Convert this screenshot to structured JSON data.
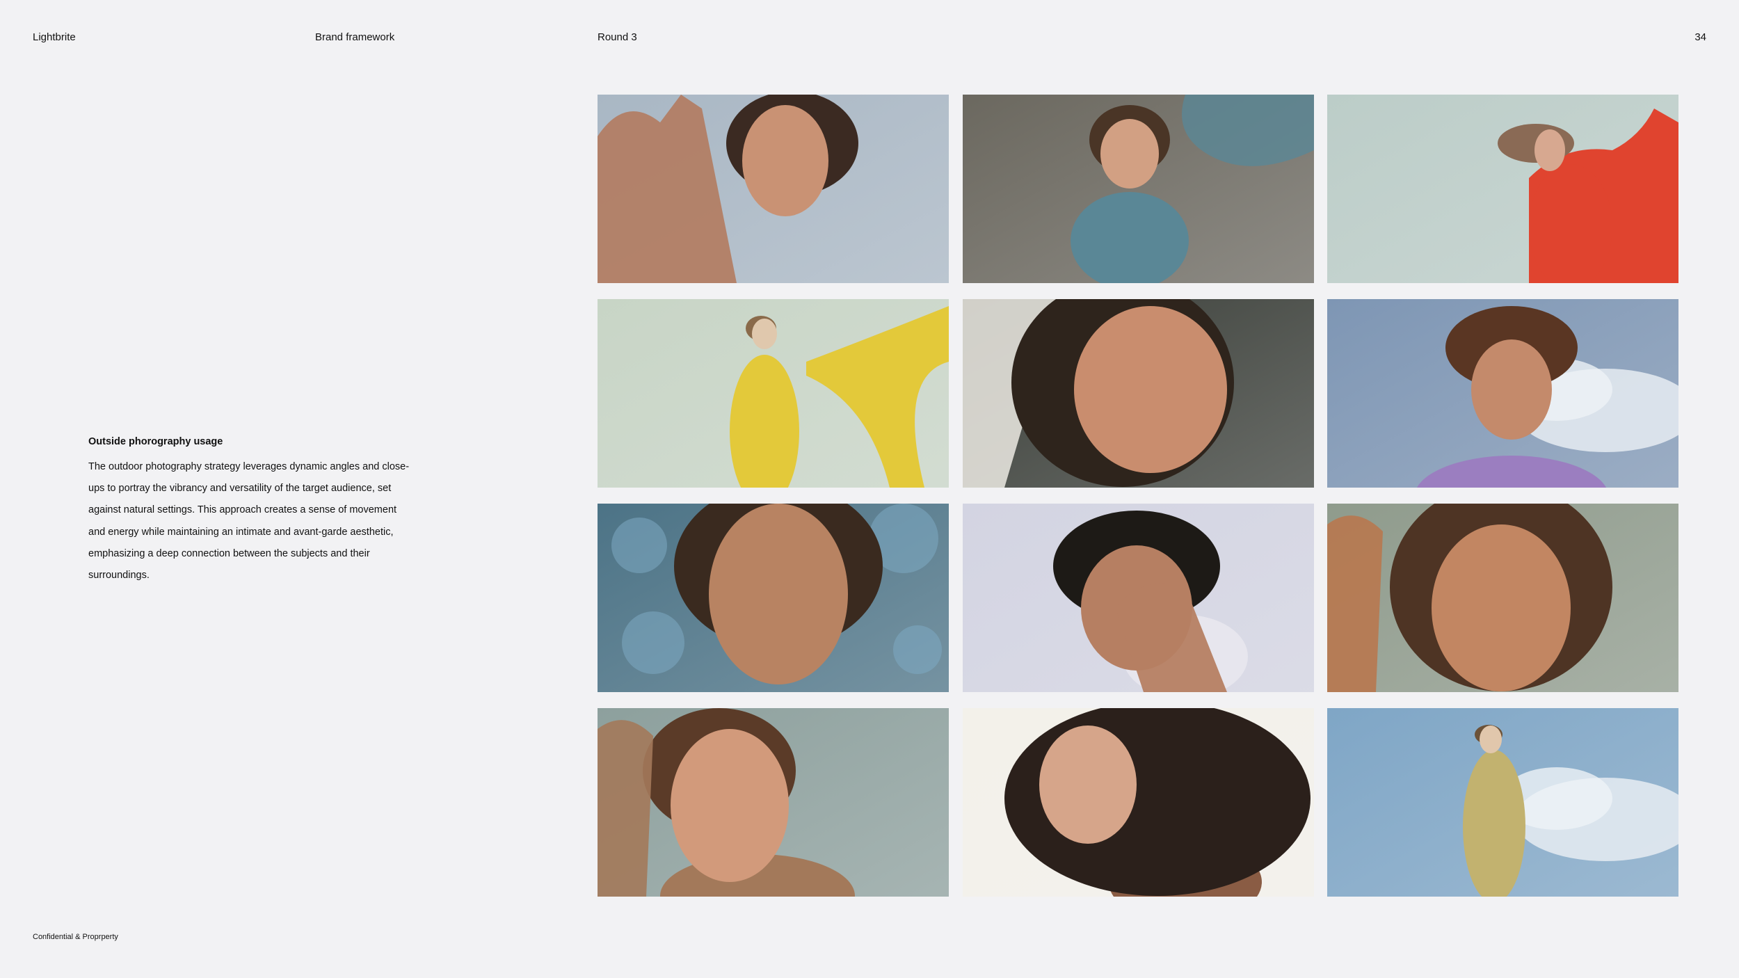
{
  "header": {
    "brand": "Lightbrite",
    "section": "Brand framework",
    "round": "Round 3",
    "page_number": "34"
  },
  "body": {
    "heading": "Outside phorography usage",
    "paragraph": "The outdoor photography strategy leverages dynamic angles and close-ups to portray the vibrancy and versatility of the target audience, set against natural settings. This approach creates a sense of movement and energy while maintaining an intimate and avant-garde aesthetic, emphasizing a deep connection between the subjects and their surroundings."
  },
  "footer": {
    "notice": "Confidential & Proprperty"
  },
  "photos": [
    {
      "name": "photo-woman-hand-raised",
      "bg": "#a9b7c4",
      "skin": "#c99274",
      "hair": "#3b2a22",
      "accent": "#b27b5f"
    },
    {
      "name": "photo-woman-sand-shore",
      "bg": "#6b685f",
      "skin": "#d2a083",
      "hair": "#4a3526",
      "accent": "#5a8796"
    },
    {
      "name": "photo-woman-red-dress-wind",
      "bg": "#bccdc8",
      "skin": "#d7a890",
      "hair": "#8a6a55",
      "accent": "#e0442f"
    },
    {
      "name": "photo-figure-yellow-scarf",
      "bg": "#c8d5c6",
      "skin": "#e0c8ad",
      "hair": "#8a6a4a",
      "accent": "#e3c93a"
    },
    {
      "name": "photo-woman-face-shadow",
      "bg": "#3b3f39",
      "skin": "#c98d6e",
      "hair": "#2e241c",
      "accent": "#6d6a5e"
    },
    {
      "name": "photo-young-man-sky",
      "bg": "#7e96b4",
      "skin": "#c48a6b",
      "hair": "#5a3623",
      "accent": "#9b7ec0"
    },
    {
      "name": "photo-woman-freckles-trees",
      "bg": "#4c7386",
      "skin": "#b88362",
      "hair": "#3a2a1f",
      "accent": "#7ea9c2"
    },
    {
      "name": "photo-curly-hair-hand-ring",
      "bg": "#d3d4e2",
      "skin": "#b67f62",
      "hair": "#1d1a16",
      "accent": "#e7e6ee"
    },
    {
      "name": "photo-woman-curly-freckles",
      "bg": "#8f9b8c",
      "skin": "#c28662",
      "hair": "#4e3424",
      "accent": "#b8784f"
    },
    {
      "name": "photo-woman-sweater-sage",
      "bg": "#8da09d",
      "skin": "#d29a7b",
      "hair": "#5b3b28",
      "accent": "#a3795a"
    },
    {
      "name": "photo-woman-flowing-hair",
      "bg": "#f3f1ea",
      "skin": "#d6a58a",
      "hair": "#2b201b",
      "accent": "#8a5c44"
    },
    {
      "name": "photo-figure-clouds",
      "bg": "#7fa6c6",
      "skin": "#e1c7ac",
      "hair": "#6c5238",
      "accent": "#c2b26f"
    }
  ]
}
